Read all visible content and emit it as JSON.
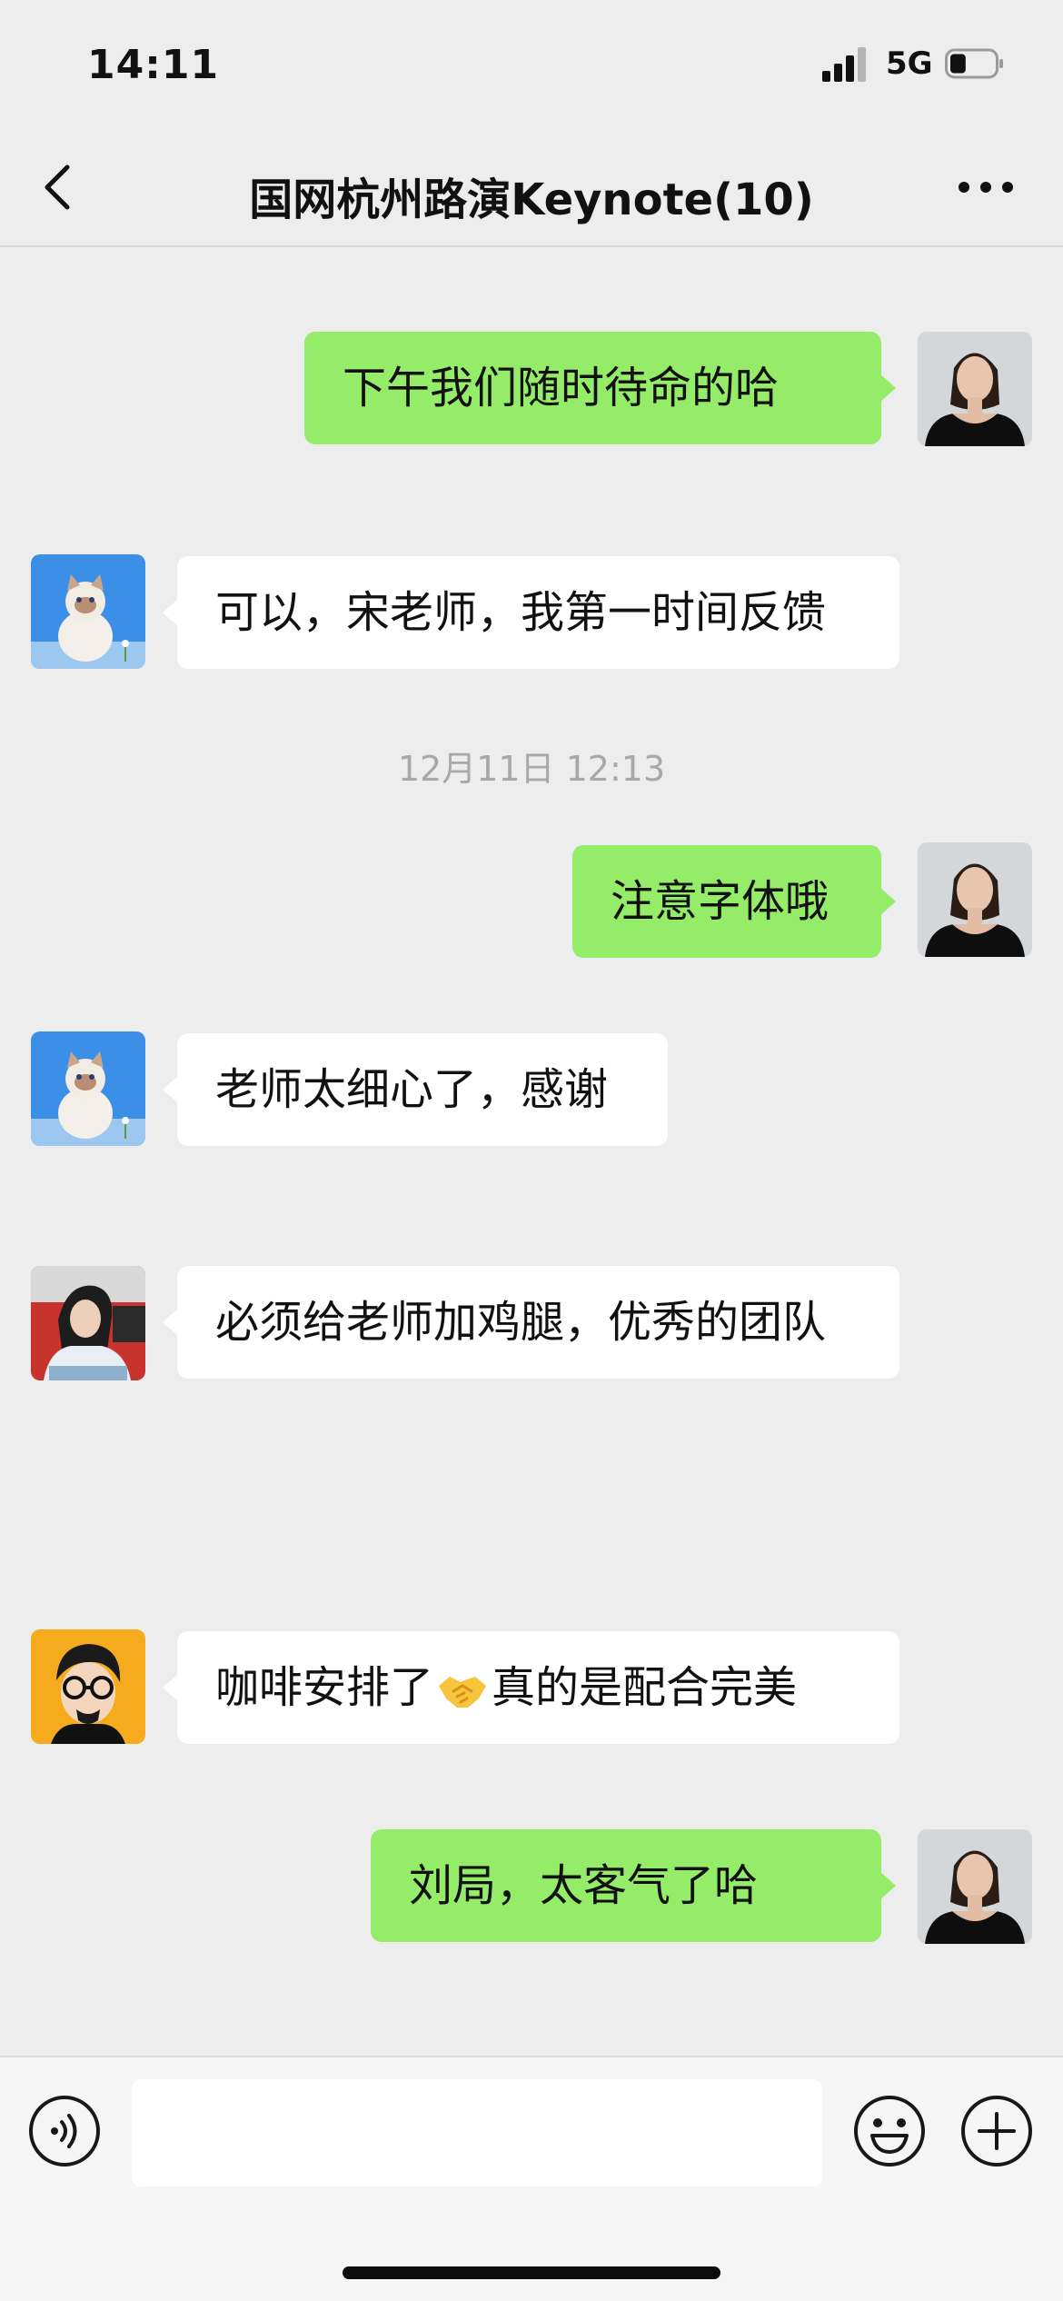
{
  "status_bar": {
    "time": "14:11",
    "network": "5G",
    "battery_level": 0.35
  },
  "header": {
    "title": "国网杭州路演Keynote(10)",
    "back_icon": "chevron-left-icon",
    "more_icon": "more-dots-icon"
  },
  "messages": [
    {
      "side": "out",
      "avatar": "woman-black-dress-avatar",
      "text": "下午我们随时待命的哈"
    },
    {
      "side": "in",
      "avatar": "white-cat-avatar",
      "text": "可以，宋老师，我第一时间反馈"
    },
    {
      "side": "out",
      "avatar": "woman-black-dress-avatar",
      "text": "注意字体哦"
    },
    {
      "side": "in",
      "avatar": "white-cat-avatar",
      "text": "老师太细心了，感谢"
    },
    {
      "side": "in",
      "avatar": "girl-red-shirt-avatar",
      "text": "必须给老师加鸡腿，优秀的团队"
    },
    {
      "side": "in",
      "avatar": "cartoon-glasses-man-avatar",
      "text_before": "咖啡安排了",
      "emoji": "handshake-emoji",
      "text_after": "真的是配合完美"
    },
    {
      "side": "out",
      "avatar": "woman-black-dress-avatar",
      "text": "刘局，太客气了哈"
    }
  ],
  "timestamp": "12月11日 12:13",
  "input_bar": {
    "voice_icon": "voice-icon",
    "emoji_icon": "emoji-face-icon",
    "plus_icon": "plus-circle-icon",
    "placeholder": ""
  },
  "colors": {
    "outgoing_bubble": "#95ec69",
    "incoming_bubble": "#ffffff",
    "background": "#ededed"
  }
}
